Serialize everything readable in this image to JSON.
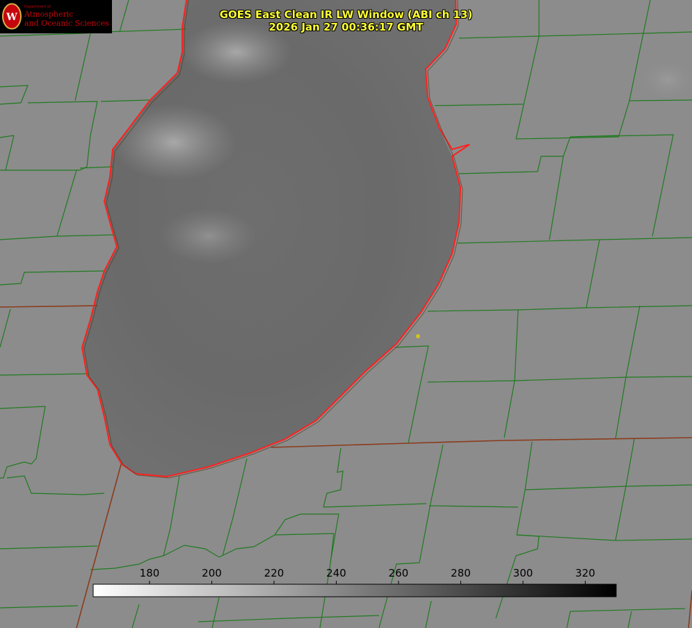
{
  "header": {
    "title": "GOES East Clean IR LW Window (ABI ch 13)",
    "timestamp": "2026 Jan 27 00:36:17 GMT"
  },
  "logo": {
    "department": "Department of",
    "line1": "Atmospheric",
    "line2": "and Oceanic Sciences",
    "seal_letter": "W",
    "color": "#c5050c"
  },
  "colorbar": {
    "ticks": [
      "180",
      "200",
      "220",
      "240",
      "260",
      "280",
      "300",
      "320"
    ],
    "gradient": "white-to-black"
  },
  "colors": {
    "title": "#ffff33",
    "coastline": "#ff2020",
    "county_borders": "#1f7a1f",
    "state_borders": "#8b3a1a",
    "marker": "#d4c21e"
  }
}
